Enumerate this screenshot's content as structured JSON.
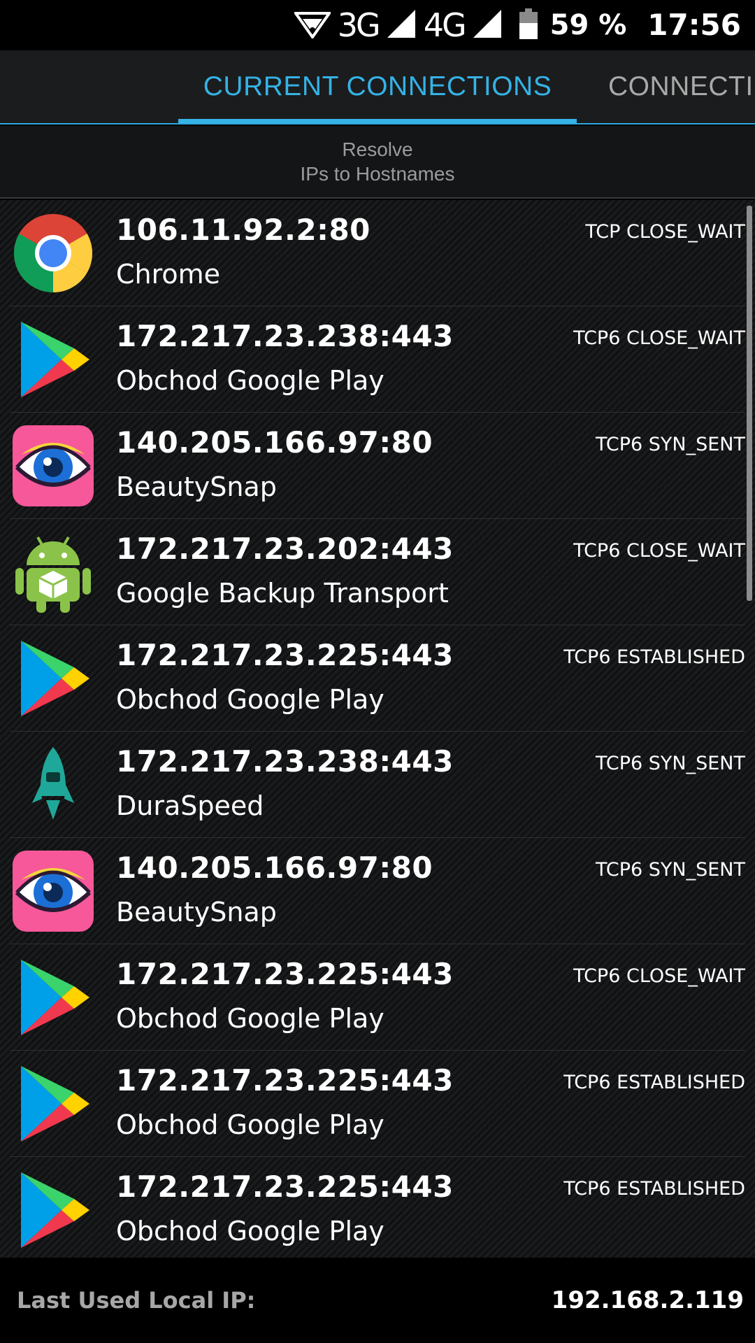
{
  "status_bar": {
    "net_3g": "3G",
    "net_4g": "4G",
    "battery_percent": "59 %",
    "time": "17:56",
    "icons": [
      "wifi-hotspot-icon",
      "signal-3g-icon",
      "signal-4g-icon",
      "battery-icon"
    ]
  },
  "tabs": [
    {
      "label": "CURRENT CONNECTIONS",
      "active": true
    },
    {
      "label": "CONNECTI",
      "active": false
    }
  ],
  "toolbar": {
    "resolve_line1": "Resolve",
    "resolve_line2": "IPs to Hostnames"
  },
  "connections": [
    {
      "address": "106.11.92.2:80",
      "app": "Chrome",
      "state": "TCP CLOSE_WAIT",
      "icon": "chrome-icon"
    },
    {
      "address": "172.217.23.238:443",
      "app": "Obchod Google Play",
      "state": "TCP6 CLOSE_WAIT",
      "icon": "google-play-icon"
    },
    {
      "address": "140.205.166.97:80",
      "app": "BeautySnap",
      "state": "TCP6 SYN_SENT",
      "icon": "beautysnap-icon"
    },
    {
      "address": "172.217.23.202:443",
      "app": "Google Backup Transport",
      "state": "TCP6 CLOSE_WAIT",
      "icon": "android-package-icon"
    },
    {
      "address": "172.217.23.225:443",
      "app": "Obchod Google Play",
      "state": "TCP6 ESTABLISHED",
      "icon": "google-play-icon"
    },
    {
      "address": "172.217.23.238:443",
      "app": "DuraSpeed",
      "state": "TCP6 SYN_SENT",
      "icon": "duraspeed-rocket-icon"
    },
    {
      "address": "140.205.166.97:80",
      "app": "BeautySnap",
      "state": "TCP6 SYN_SENT",
      "icon": "beautysnap-icon"
    },
    {
      "address": "172.217.23.225:443",
      "app": "Obchod Google Play",
      "state": "TCP6 CLOSE_WAIT",
      "icon": "google-play-icon"
    },
    {
      "address": "172.217.23.225:443",
      "app": "Obchod Google Play",
      "state": "TCP6 ESTABLISHED",
      "icon": "google-play-icon"
    },
    {
      "address": "172.217.23.225:443",
      "app": "Obchod Google Play",
      "state": "TCP6 ESTABLISHED",
      "icon": "google-play-icon"
    }
  ],
  "footer": {
    "label": "Last Used Local IP:",
    "ip": "192.168.2.119"
  },
  "colors": {
    "accent": "#35b2e6",
    "background": "#000000",
    "tab_inactive": "#a9a9a9"
  }
}
